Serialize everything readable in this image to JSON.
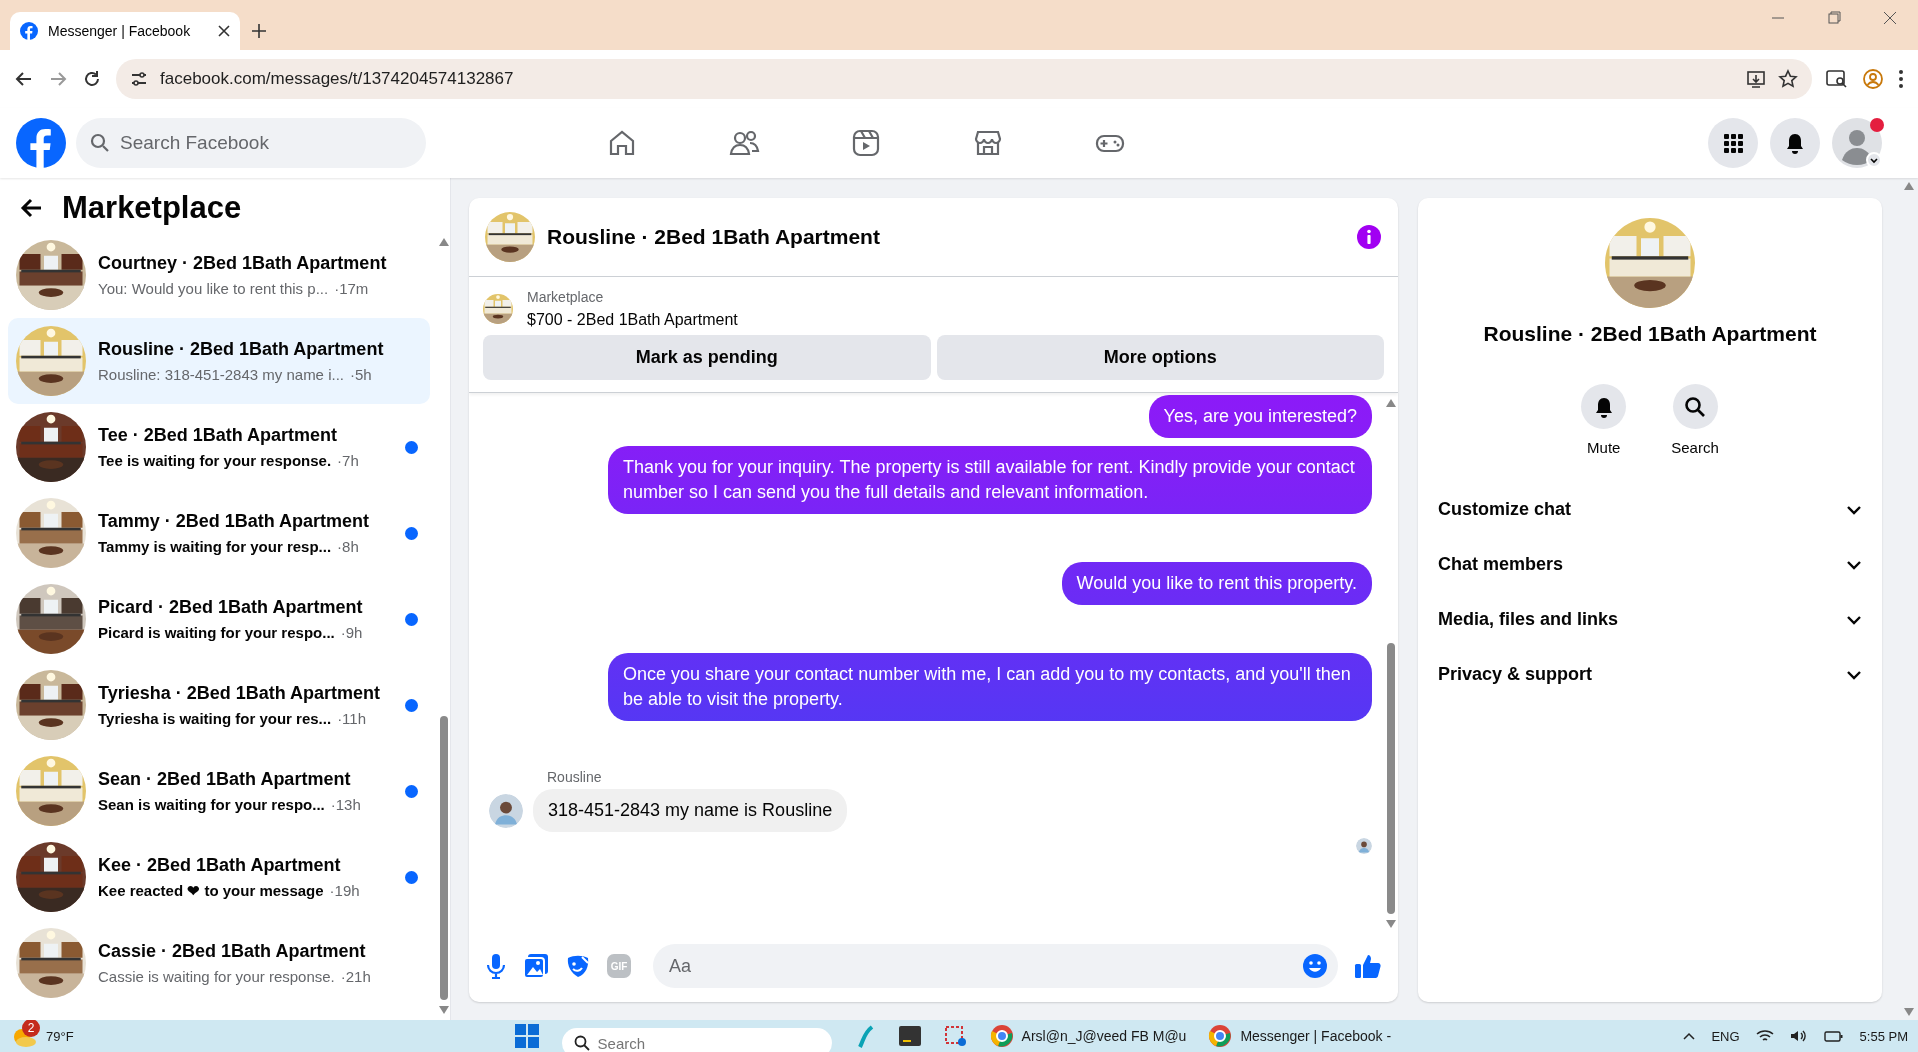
{
  "browser": {
    "tab_title": "Messenger | Facebook",
    "url": "facebook.com/messages/t/1374204574132867"
  },
  "topbar": {
    "search": {
      "placeholder": "Search Facebook"
    },
    "notification_dot": true
  },
  "sidebar": {
    "title": "Marketplace",
    "conversations": [
      {
        "name": "Courtney · 2Bed 1Bath Apartment",
        "preview": "You: Would you like to rent this p...",
        "time": "·17m",
        "unread": false,
        "selected": false
      },
      {
        "name": "Rousline · 2Bed 1Bath Apartment",
        "preview": "Rousline: 318-451-2843 my name i...",
        "time": "·5h",
        "unread": false,
        "selected": true
      },
      {
        "name": "Tee · 2Bed 1Bath Apartment",
        "preview": "Tee is waiting for your response.",
        "time": "·7h",
        "unread": true,
        "selected": false
      },
      {
        "name": "Tammy · 2Bed 1Bath Apartment",
        "preview": "Tammy is waiting for your resp...",
        "time": "·8h",
        "unread": true,
        "selected": false
      },
      {
        "name": "Picard · 2Bed 1Bath Apartment",
        "preview": "Picard is waiting for your respo...",
        "time": "·9h",
        "unread": true,
        "selected": false
      },
      {
        "name": "Tyriesha · 2Bed 1Bath Apartment",
        "preview": "Tyriesha is waiting for your res...",
        "time": "·11h",
        "unread": true,
        "selected": false
      },
      {
        "name": "Sean · 2Bed 1Bath Apartment",
        "preview": "Sean is waiting for your respo...",
        "time": "·13h",
        "unread": true,
        "selected": false
      },
      {
        "name": "Kee · 2Bed 1Bath Apartment",
        "preview": "Kee reacted ❤ to your message",
        "time": "·19h",
        "unread": true,
        "selected": false
      },
      {
        "name": "Cassie · 2Bed 1Bath Apartment",
        "preview": "Cassie is waiting for your response.",
        "time": "·21h",
        "unread": false,
        "selected": false
      }
    ]
  },
  "chat": {
    "title": "Rousline · 2Bed 1Bath Apartment",
    "listing": {
      "source": "Marketplace",
      "title": "$700 - 2Bed 1Bath Apartment"
    },
    "buttons": [
      "Mark as pending",
      "More options"
    ],
    "messages": [
      {
        "kind": "sent",
        "text": "Yes, are you interested?"
      },
      {
        "kind": "sent",
        "text": "Thank you for your inquiry. The property is still available for rent. Kindly provide your contact number so I can send you the full details and relevant information."
      },
      {
        "kind": "sent",
        "text": "Would you like to rent this property."
      },
      {
        "kind": "sent",
        "text": "Once you share your contact number with me, I can add you to my contacts, and you'll then be able to visit the property."
      },
      {
        "kind": "received",
        "sender": "Rousline",
        "text": "318-451-2843 my name is Rousline"
      }
    ],
    "composer": {
      "placeholder": "Aa",
      "gif": "GIF"
    }
  },
  "info": {
    "title": "Rousline · 2Bed 1Bath Apartment",
    "actions": [
      {
        "kind": "mute",
        "label": "Mute"
      },
      {
        "kind": "search",
        "label": "Search"
      }
    ],
    "sections": [
      {
        "label": "Customize chat",
        "expanded": false
      },
      {
        "label": "Chat members",
        "expanded": false
      },
      {
        "label": "Media, files and links",
        "expanded": false
      },
      {
        "label": "Privacy & support",
        "expanded": false
      }
    ]
  },
  "taskbar": {
    "weather": "79°F",
    "weather_badge": "2",
    "search": {
      "placeholder": "Search"
    },
    "windows": [
      "Arsl@n_J@veed FB M@u",
      "Messenger | Facebook -"
    ],
    "language": "ENG",
    "time": "5:55 PM"
  }
}
